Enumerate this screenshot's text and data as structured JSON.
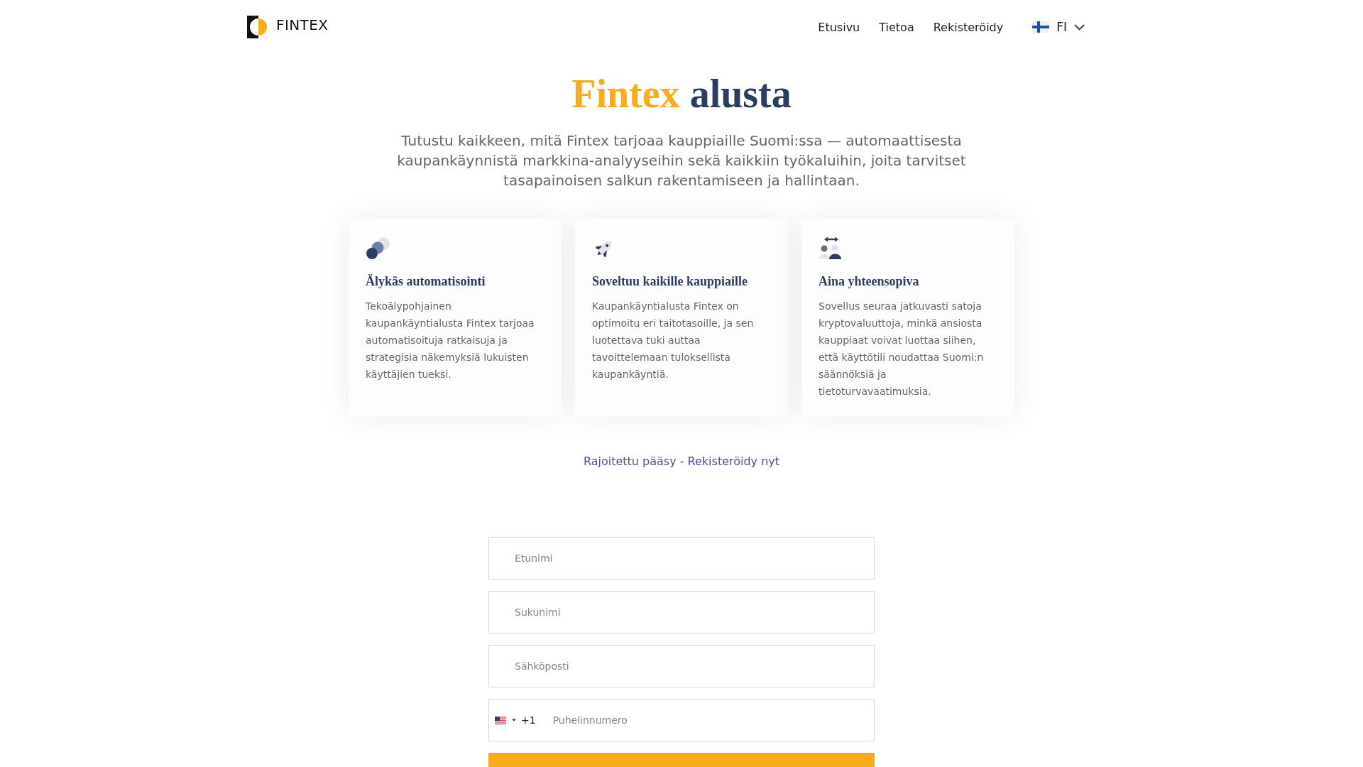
{
  "header": {
    "logo": "FINTEX",
    "nav": [
      {
        "label": "Etusivu"
      },
      {
        "label": "Tietoa"
      },
      {
        "label": "Rekisteröidy"
      }
    ],
    "language": "FI"
  },
  "hero": {
    "title": [
      {
        "text": "Fintex",
        "kind": "accent"
      },
      {
        "text": "alusta",
        "kind": "main"
      }
    ],
    "subtitle": "Tutustu kaikkeen, mitä Fintex tarjoaa kauppiaille Suomi:ssa — automaattisesta kaupankäynnistä markkina-analyyseihin sekä kaikkiin työkaluihin, joita tarvitset tasapainoisen salkun rakentamiseen ja hallintaan."
  },
  "features": [
    {
      "kind": "circles",
      "title": "Älykäs automatisointi",
      "text": "Tekoälypohjainen kaupankäyntialusta Fintex tarjoaa automatisoituja ratkaisuja ja strategisia näkemyksiä lukuisten käyttäjien tueksi."
    },
    {
      "kind": "rocket",
      "title": "Soveltuu kaikille kauppiaille",
      "text": "Kaupankäyntialusta Fintex on optimoitu eri taitotasoille, ja sen luotettava tuki auttaa tavoittelemaan tuloksellista kaupankäyntiä."
    },
    {
      "kind": "people",
      "title": "Aina yhteensopiva",
      "text": "Sovellus seuraa jatkuvasti satoja kryptovaluuttoja, minkä ansiosta kauppiaat voivat luottaa siihen, että käyttötili noudattaa Suomi:n säännöksiä ja tietoturvavaatimuksia."
    }
  ],
  "register_link": "Rajoitettu pääsy - Rekisteröidy nyt",
  "form": {
    "fields": [
      {
        "kind": "text",
        "placeholder": "Etunimi"
      },
      {
        "kind": "text",
        "placeholder": "Sukunimi"
      },
      {
        "kind": "email",
        "placeholder": "Sähköposti"
      },
      {
        "kind": "phone",
        "dial_code": "+1",
        "placeholder": "Puhelinnumero"
      }
    ]
  }
}
